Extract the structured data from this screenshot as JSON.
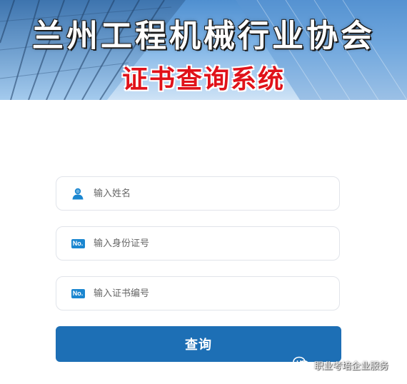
{
  "header": {
    "org_title": "兰州工程机械行业协会",
    "system_title": "证书查询系统"
  },
  "form": {
    "name_field": {
      "placeholder": "输入姓名",
      "icon": "user-icon"
    },
    "id_field": {
      "placeholder": "输入身份证号",
      "badge": "No."
    },
    "cert_field": {
      "placeholder": "输入证书编号",
      "badge": "No."
    },
    "submit_label": "查询"
  },
  "watermark": {
    "text": "职业考培企业服务"
  },
  "colors": {
    "button": "#1d6fb5",
    "system_title": "#e0121a",
    "badge": "#1a86d0"
  }
}
